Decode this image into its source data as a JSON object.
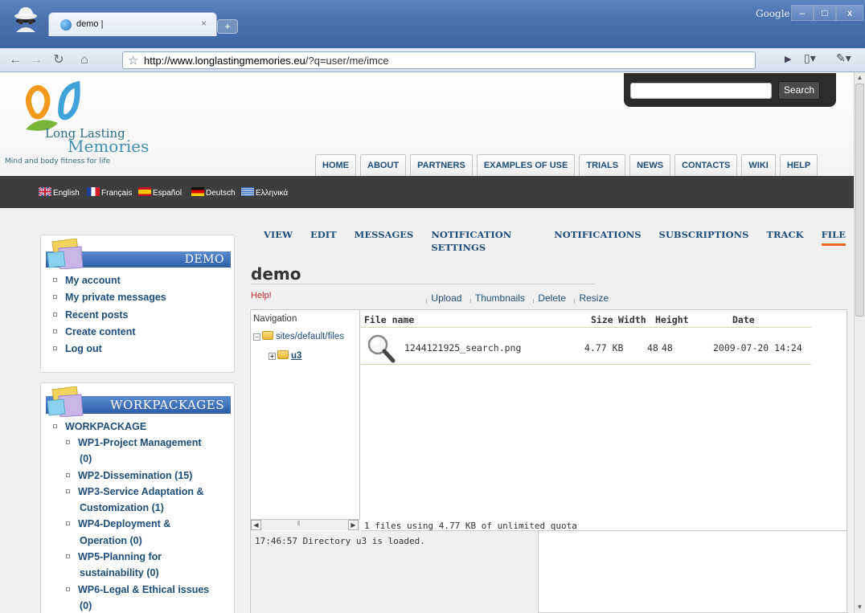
{
  "browser": {
    "tab_title": "demo |",
    "tab_close": "×",
    "new_tab": "+",
    "window_title": "Google",
    "url_host": "http://www.longlastingmemories.eu",
    "url_path": "/?q=user/me/imce",
    "window_buttons": [
      "–",
      "□",
      "x"
    ]
  },
  "site": {
    "brand_line1": "Long Lasting",
    "brand_line2": "Memories",
    "tagline": "Mind and body fitness for life",
    "search_button": "Search",
    "search_value": "",
    "main_nav": [
      "HOME",
      "ABOUT",
      "PARTNERS",
      "EXAMPLES OF USE",
      "TRIALS",
      "NEWS",
      "CONTACTS",
      "WIKI",
      "HELP"
    ],
    "languages": [
      "English",
      "Français",
      "Español",
      "Deutsch",
      "Ελληνικά"
    ]
  },
  "sidebar": {
    "demo_block": {
      "title": "DEMO",
      "items": [
        "My account",
        "My private messages",
        "Recent posts",
        "Create content",
        "Log out"
      ]
    },
    "wp_block": {
      "title": "WORKPACKAGES",
      "root": "WORKPACKAGE",
      "items": [
        "WP1-Project Management",
        "(0)",
        "WP2-Dissemination (15)",
        "WP3-Service Adaptation &",
        "Customization (1)",
        "WP4-Deployment &",
        "Operation (0)",
        "WP5-Planning for",
        "sustainability (0)",
        "WP6-Legal & Ethical issues",
        "(0)"
      ]
    }
  },
  "content": {
    "tabs": [
      "VIEW",
      "EDIT",
      "MESSAGES",
      "NOTIFICATION SETTINGS",
      "NOTIFICATIONS",
      "SUBSCRIPTIONS",
      "TRACK",
      "FILE"
    ],
    "active_tab": "FILE",
    "title": "demo",
    "help": "Help!",
    "ops": [
      "Upload",
      "Thumbnails",
      "Delete",
      "Resize"
    ],
    "imce": {
      "nav_header": "Navigation",
      "tree_root": "sites/default/files",
      "tree_child": "u3",
      "columns": [
        "File name",
        "Size",
        "Width",
        "Height",
        "Date"
      ],
      "file": {
        "name": "1244121925_search.png",
        "size": "4.77 KB",
        "width": "48",
        "height": "48",
        "date": "2009-07-20 14:24"
      },
      "quota": "1 files using 4.77 KB of unlimited quota",
      "log": "17:46:57 Directory u3 is loaded."
    }
  }
}
